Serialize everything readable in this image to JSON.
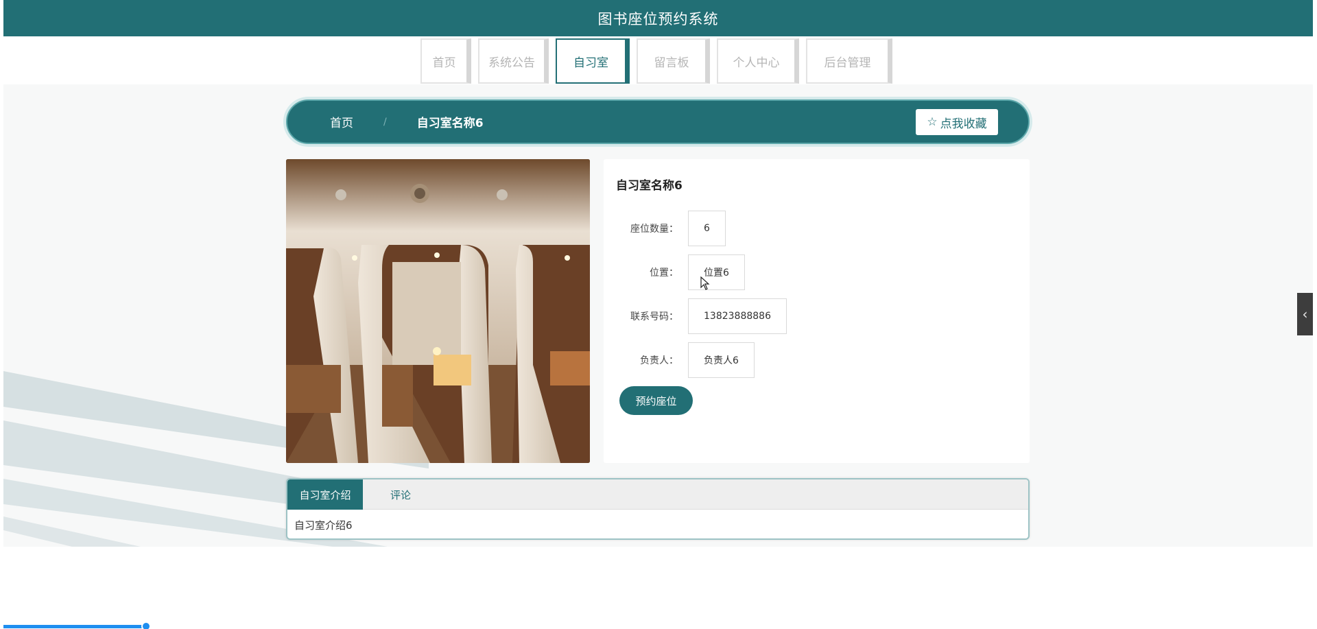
{
  "header": {
    "title": "图书座位预约系统"
  },
  "nav": {
    "items": [
      {
        "label": "首页"
      },
      {
        "label": "系统公告"
      },
      {
        "label": "自习室"
      },
      {
        "label": "留言板"
      },
      {
        "label": "个人中心"
      },
      {
        "label": "后台管理"
      }
    ],
    "active": "自习室"
  },
  "breadcrumb": {
    "home": "首页",
    "separator": "/",
    "current": "自习室名称6",
    "favorite_label": "点我收藏",
    "favorite_icon": "star-outline-icon"
  },
  "room": {
    "name": "自习室名称6",
    "fields": [
      {
        "label": "座位数量：",
        "value": "6"
      },
      {
        "label": "位置：",
        "value": "位置6"
      },
      {
        "label": "联系号码：",
        "value": "13823888886"
      },
      {
        "label": "负责人：",
        "value": "负责人6"
      }
    ],
    "reserve_label": "预约座位"
  },
  "tabs": {
    "items": [
      {
        "label": "自习室介绍"
      },
      {
        "label": "评论"
      }
    ],
    "active": "自习室介绍",
    "content": "自习室介绍6"
  },
  "side_handle": {
    "icon": "chevron-left-icon",
    "glyph": "‹"
  },
  "colors": {
    "primary": "#226f75",
    "header_bg": "#226f75",
    "page_bg": "#f7f8f8",
    "progress": "#1e8ef0"
  }
}
